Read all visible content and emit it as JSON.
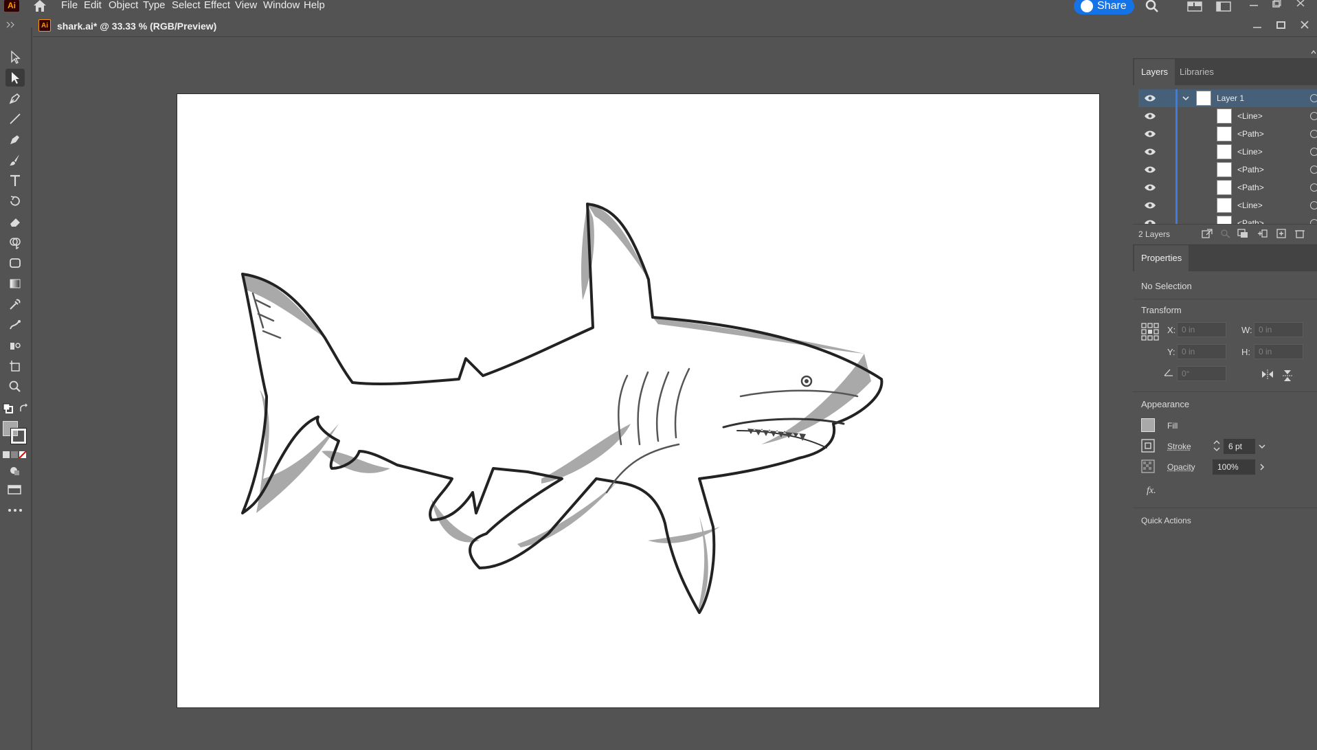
{
  "app": {
    "logo": "Ai",
    "menus": [
      "File",
      "Edit",
      "Object",
      "Type",
      "Select",
      "Effect",
      "View",
      "Window",
      "Help"
    ],
    "share_label": "Share"
  },
  "document": {
    "icon": "Ai",
    "title": "shark.ai* @ 33.33 % (RGB/Preview)"
  },
  "layers_panel": {
    "tabs": [
      "Layers",
      "Libraries"
    ],
    "layer": {
      "name": "Layer 1"
    },
    "items": [
      {
        "name": "<Line>"
      },
      {
        "name": "<Path>"
      },
      {
        "name": "<Line>"
      },
      {
        "name": "<Path>"
      },
      {
        "name": "<Path>"
      },
      {
        "name": "<Line>"
      },
      {
        "name": "<Path>"
      }
    ],
    "count": "2 Layers"
  },
  "properties_panel": {
    "tab": "Properties",
    "selection": "No Selection",
    "transform": {
      "label": "Transform",
      "x_label": "X:",
      "y_label": "Y:",
      "w_label": "W:",
      "h_label": "H:",
      "x": "0 in",
      "y": "0 in",
      "w": "0 in",
      "h": "0 in",
      "angle": "0°"
    },
    "appearance": {
      "label": "Appearance",
      "fill_label": "Fill",
      "stroke_label": "Stroke",
      "stroke_value": "6 pt",
      "opacity_label": "Opacity",
      "opacity_value": "100%",
      "fx_label": "fx."
    },
    "quick_actions_label": "Quick Actions"
  },
  "colors": {
    "accent": "#1473e6",
    "selection_row": "#46607a",
    "layer_color": "#3d7be6",
    "shark_shade": "#a9a9a9",
    "shark_outline": "#222222"
  }
}
